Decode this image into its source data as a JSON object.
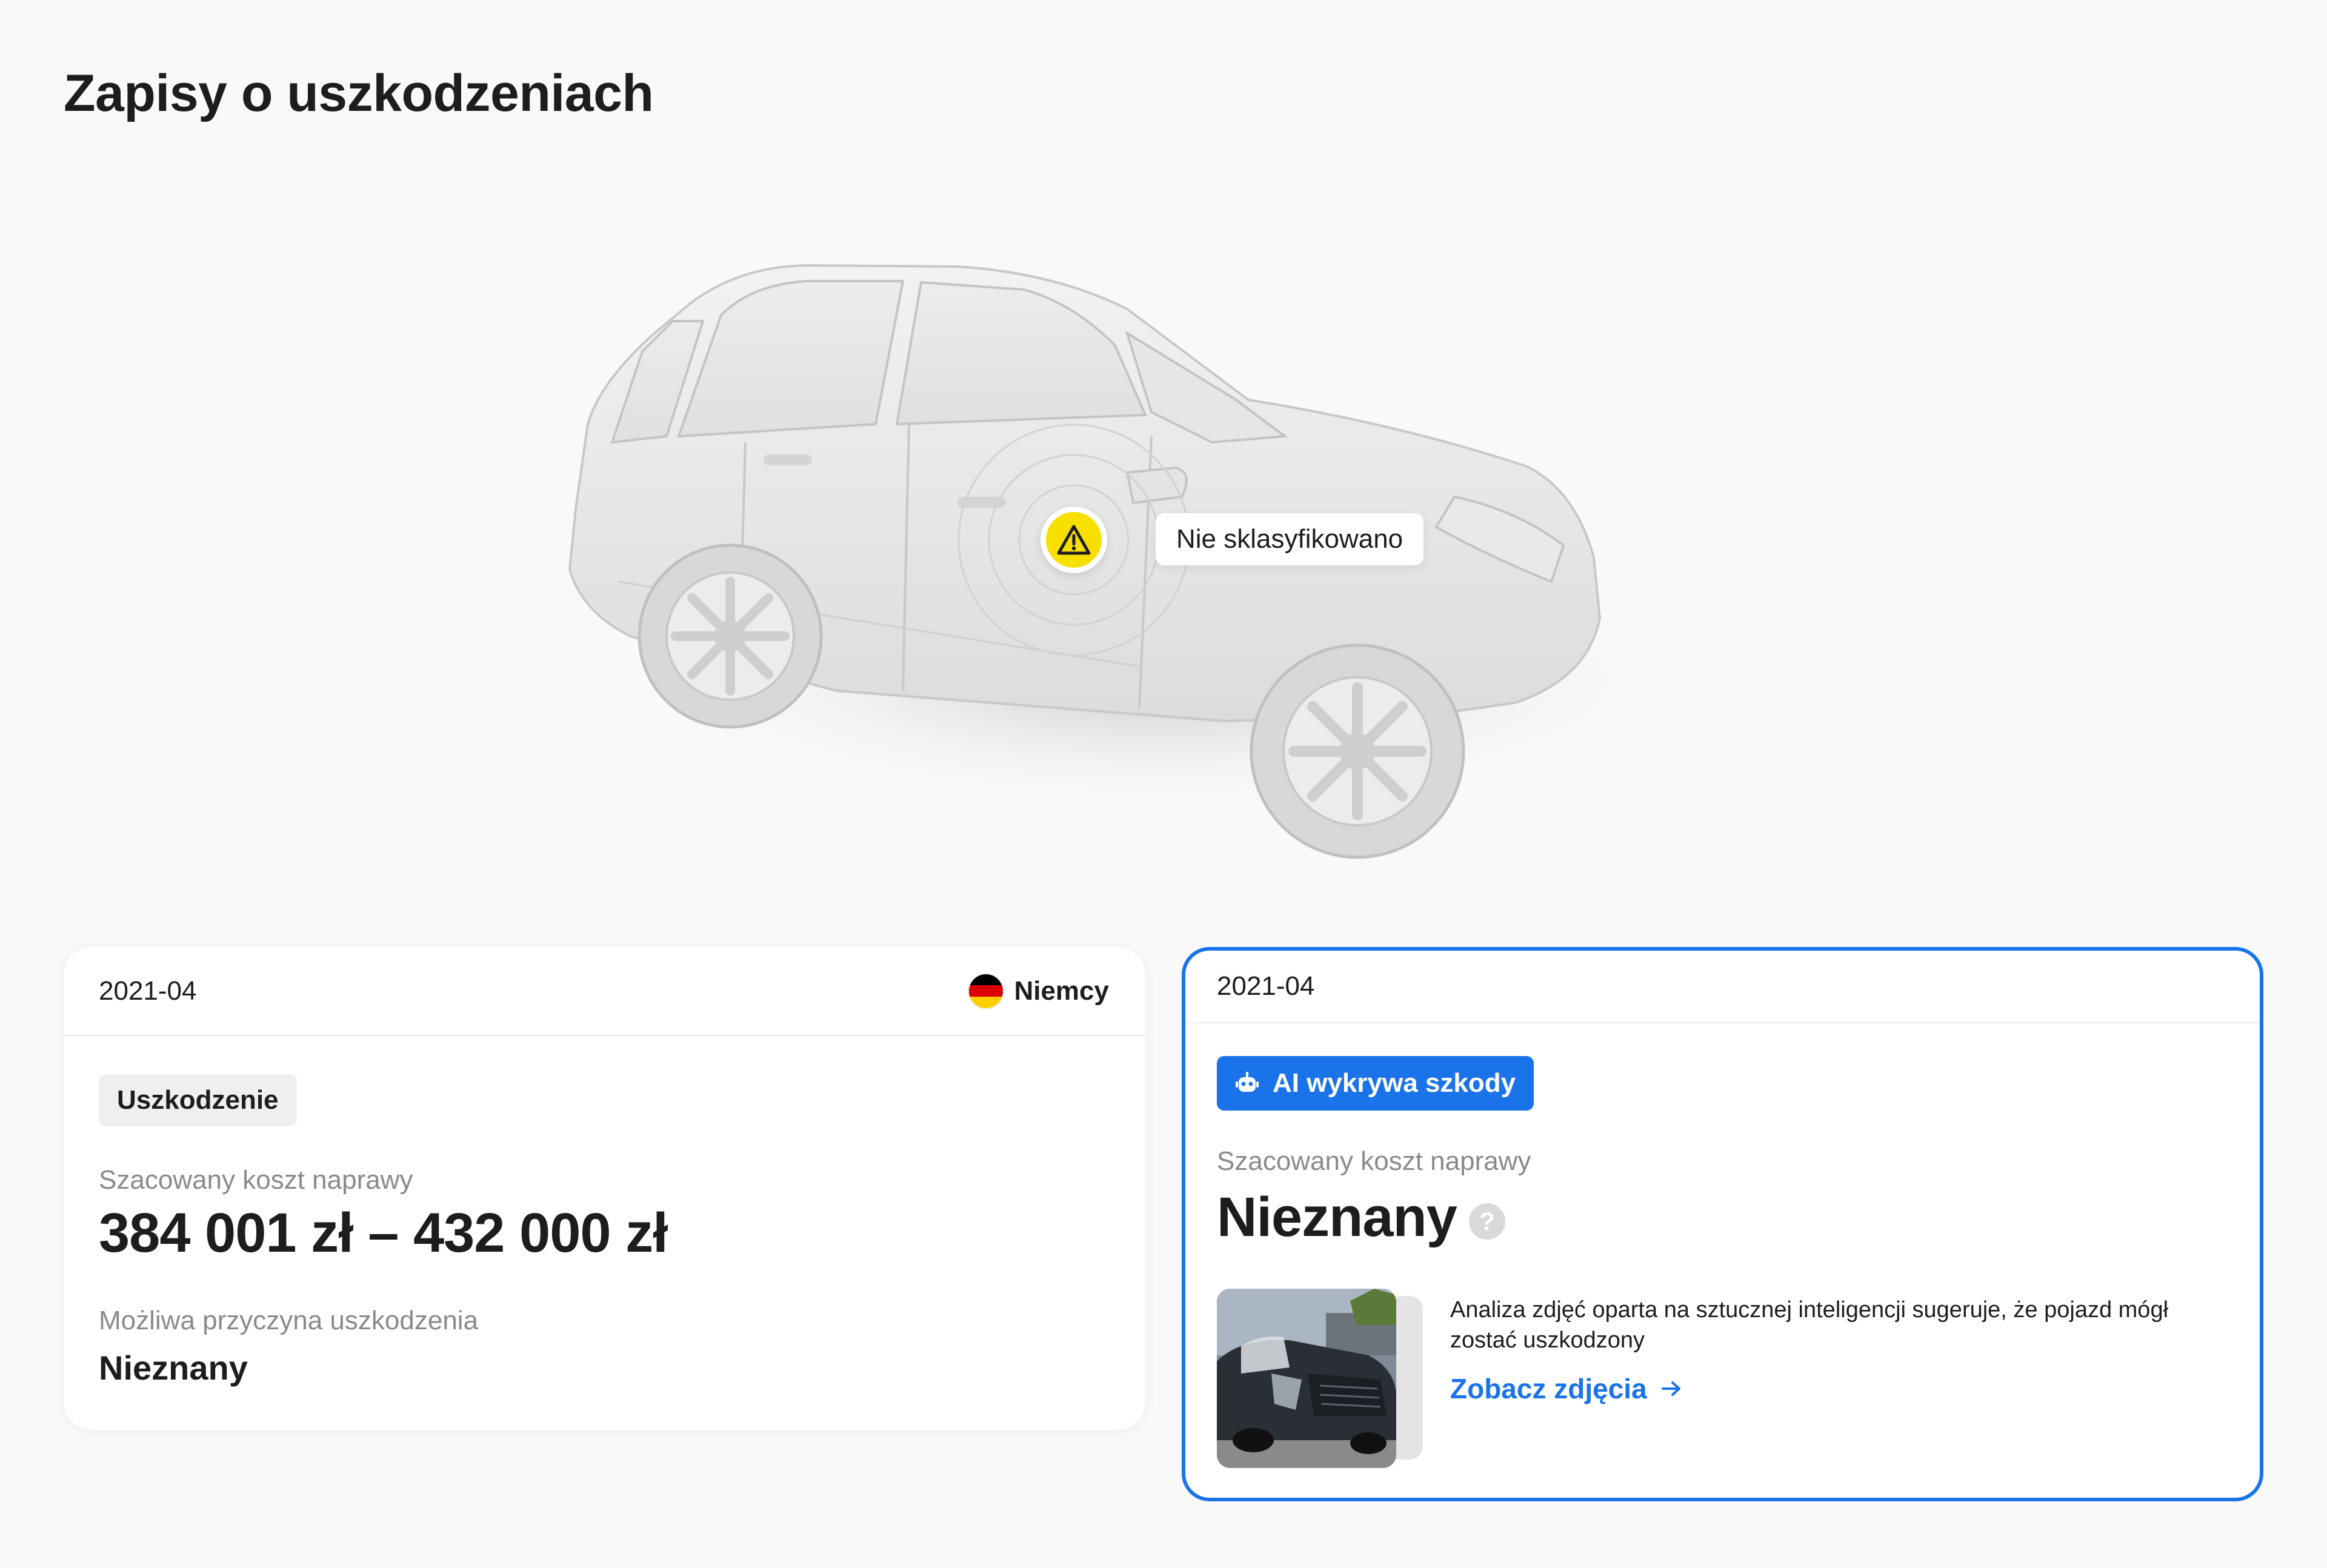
{
  "page": {
    "title": "Zapisy o uszkodzeniach"
  },
  "vehicle_diagram": {
    "marker_label": "Nie sklasyfikowano",
    "marker_icon": "warning-triangle-icon",
    "marker_color": "#f7e000"
  },
  "records": [
    {
      "date": "2021-04",
      "country": {
        "name": "Niemcy",
        "flag": "germany-flag-icon",
        "flag_colors": [
          "#000000",
          "#dd0000",
          "#ffce00"
        ]
      },
      "tag": "Uszkodzenie",
      "cost_label": "Szacowany koszt naprawy",
      "cost_value": "384 001 zł – 432 000 zł",
      "cause_label": "Możliwa przyczyna uszkodzenia",
      "cause_value": "Nieznany"
    },
    {
      "date": "2021-04",
      "badge": "AI wykrywa szkody",
      "badge_icon": "robot-icon",
      "cost_label": "Szacowany koszt naprawy",
      "cost_value": "Nieznany",
      "help_icon": "question-mark-icon",
      "help_glyph": "?",
      "description": "Analiza zdjęć oparta na sztucznej inteligencji sugeruje, że pojazd mógł zostać uszkodzony",
      "link_label": "Zobacz zdjęcia",
      "link_icon": "arrow-right-icon",
      "accent_color": "#1a73e8"
    }
  ]
}
